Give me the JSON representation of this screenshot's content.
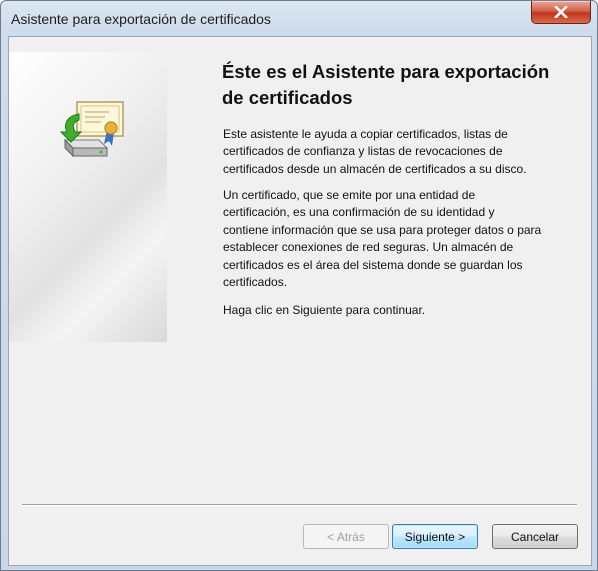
{
  "window": {
    "title": "Asistente para exportación de certificados",
    "close_label": "Cerrar"
  },
  "wizard": {
    "heading": "Éste es el Asistente para exportación de certificados",
    "paragraphs": [
      "Este asistente le ayuda a copiar certificados, listas de certificados de confianza y listas de revocaciones de certificados desde un almacén de certificados a su disco.",
      "Un certificado, que se emite por una entidad de certificación, es una confirmación de su identidad y contiene información que se usa para proteger datos o para establecer conexiones de red seguras. Un almacén de certificados es el área del sistema donde se guardan los certificados.",
      "Haga clic en Siguiente para continuar."
    ],
    "icon": "certificate-export-icon"
  },
  "buttons": {
    "back": {
      "label": "< Atrás",
      "enabled": false
    },
    "next": {
      "label": "Siguiente >",
      "enabled": true
    },
    "cancel": {
      "label": "Cancelar",
      "enabled": true
    }
  },
  "colors": {
    "titlebar": "#cfdceb",
    "close_button": "#c2351d",
    "dialog_background": "#f0f0f0",
    "default_button_border": "#3c7fb1"
  }
}
